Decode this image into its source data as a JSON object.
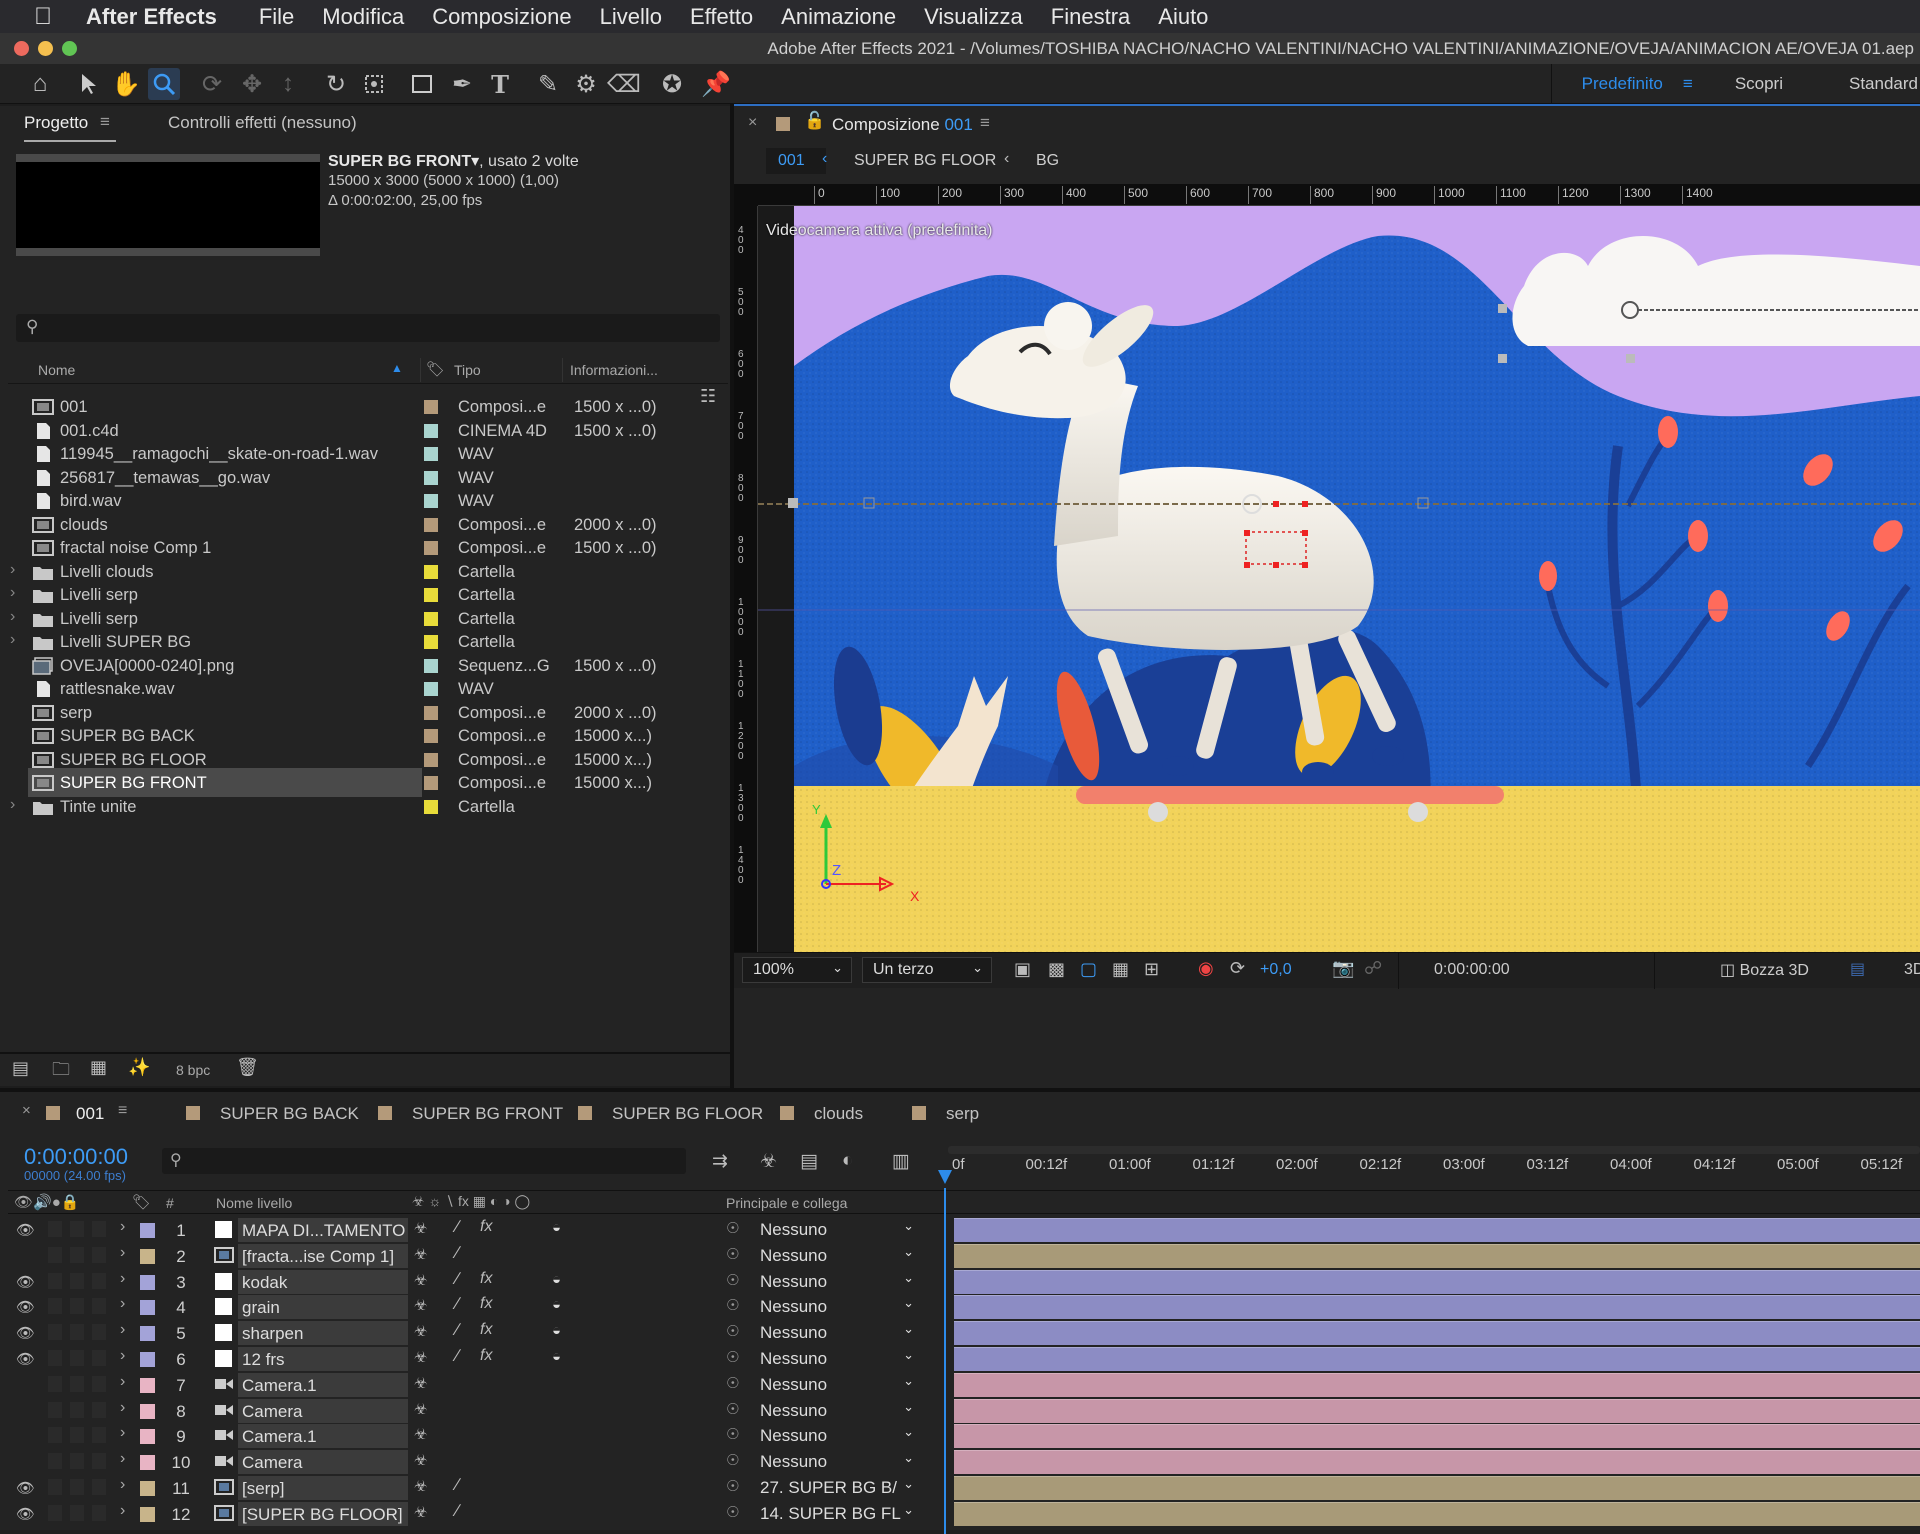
{
  "menubar": {
    "apple": "",
    "app": "After Effects",
    "items": [
      "File",
      "Modifica",
      "Composizione",
      "Livello",
      "Effetto",
      "Animazione",
      "Visualizza",
      "Finestra",
      "Aiuto"
    ]
  },
  "window_title": "Adobe After Effects 2021 - /Volumes/TOSHIBA NACHO/NACHO VALENTINI/NACHO VALENTINI/ANIMAZIONE/OVEJA/ANIMACION AE/OVEJA 01.aep",
  "workspace": {
    "active": "Predefinito",
    "items": [
      "Scopri",
      "Standard"
    ]
  },
  "project_panel": {
    "tab": "Progetto",
    "tab2": "Controlli effetti (nessuno)",
    "selected_name": "SUPER BG FRONT▾",
    "selected_usage": ", usato 2 volte",
    "selected_dims": "15000 x 3000  (5000 x 1000) (1,00)",
    "selected_dur": "Δ 0:00:02:00, 25,00 fps",
    "columns": [
      "Nome",
      "Tipo",
      "Informazioni..."
    ],
    "bpc": "8 bpc",
    "items": [
      {
        "name": "001",
        "type": "Composi...e",
        "info": "1500 x ...0)",
        "color": "#b49a7a",
        "icon": "comp",
        "folder": false
      },
      {
        "name": "001.c4d",
        "type": "CINEMA 4D",
        "info": "1500 x ...0)",
        "color": "#a9d4cf",
        "icon": "file",
        "folder": false
      },
      {
        "name": "119945__ramagochi__skate-on-road-1.wav",
        "type": "WAV",
        "info": "",
        "color": "#a9d4cf",
        "icon": "file",
        "folder": false
      },
      {
        "name": "256817__temawas__go.wav",
        "type": "WAV",
        "info": "",
        "color": "#a9d4cf",
        "icon": "file",
        "folder": false
      },
      {
        "name": "bird.wav",
        "type": "WAV",
        "info": "",
        "color": "#a9d4cf",
        "icon": "file",
        "folder": false
      },
      {
        "name": "clouds",
        "type": "Composi...e",
        "info": "2000 x ...0)",
        "color": "#b49a7a",
        "icon": "comp",
        "folder": false
      },
      {
        "name": "fractal noise Comp 1",
        "type": "Composi...e",
        "info": "1500 x ...0)",
        "color": "#b49a7a",
        "icon": "comp",
        "folder": false
      },
      {
        "name": "Livelli clouds",
        "type": "Cartella",
        "info": "",
        "color": "#e8dc3a",
        "icon": "folder",
        "folder": true
      },
      {
        "name": "Livelli serp",
        "type": "Cartella",
        "info": "",
        "color": "#e8dc3a",
        "icon": "folder",
        "folder": true
      },
      {
        "name": "Livelli serp",
        "type": "Cartella",
        "info": "",
        "color": "#e8dc3a",
        "icon": "folder",
        "folder": true
      },
      {
        "name": "Livelli SUPER BG",
        "type": "Cartella",
        "info": "",
        "color": "#e8dc3a",
        "icon": "folder",
        "folder": true
      },
      {
        "name": "OVEJA[0000-0240].png",
        "type": "Sequenz...G",
        "info": "1500 x ...0)",
        "color": "#a9d4cf",
        "icon": "seq",
        "folder": false
      },
      {
        "name": "rattlesnake.wav",
        "type": "WAV",
        "info": "",
        "color": "#a9d4cf",
        "icon": "file",
        "folder": false
      },
      {
        "name": "serp",
        "type": "Composi...e",
        "info": "2000 x ...0)",
        "color": "#b49a7a",
        "icon": "comp",
        "folder": false
      },
      {
        "name": "SUPER BG BACK",
        "type": "Composi...e",
        "info": "15000 x...)",
        "color": "#b49a7a",
        "icon": "comp",
        "folder": false
      },
      {
        "name": "SUPER BG FLOOR",
        "type": "Composi...e",
        "info": "15000 x...)",
        "color": "#b49a7a",
        "icon": "comp",
        "folder": false
      },
      {
        "name": "SUPER BG FRONT",
        "type": "Composi...e",
        "info": "15000 x...)",
        "color": "#b49a7a",
        "icon": "comp",
        "folder": false,
        "selected": true
      },
      {
        "name": "Tinte unite",
        "type": "Cartella",
        "info": "",
        "color": "#e8dc3a",
        "icon": "folder",
        "folder": true
      }
    ]
  },
  "comp_panel": {
    "tab_prefix": "Composizione",
    "tab_name": "001",
    "breadcrumbs": [
      "001",
      "SUPER BG FLOOR",
      "BG"
    ],
    "ruler": [
      "0",
      "100",
      "200",
      "300",
      "400",
      "500",
      "600",
      "700",
      "800",
      "900",
      "1000",
      "1100",
      "1200",
      "1300",
      "1400"
    ],
    "vruler": [
      "4 0 0",
      "5 0 0",
      "6 0 0",
      "7 0 0",
      "8 0 0",
      "9 0 0",
      "1 0 0 0",
      "1 1 0 0",
      "1 2 0 0",
      "1 3 0 0",
      "1 4 0 0"
    ],
    "camera_label": "Videocamera attiva (predefinita)",
    "axis": {
      "y": "Y",
      "z": "Z",
      "x": "X"
    },
    "zoom": "100%",
    "resolution": "Un terzo",
    "exposure": "+0,0",
    "timecode": "0:00:00:00",
    "renderer": "Bozza 3D",
    "extra": "3D"
  },
  "timeline": {
    "tabs": [
      "001",
      "SUPER BG BACK",
      "SUPER BG FRONT",
      "SUPER BG FLOOR",
      "clouds",
      "serp"
    ],
    "tab_colors": [
      "#b49a7a",
      "#b49a7a",
      "#b49a7a",
      "#b49a7a",
      "#b49a7a",
      "#b49a7a"
    ],
    "timecode": "0:00:00:00",
    "frame": "00000 (24.00 fps)",
    "header_num": "#",
    "header_name": "Nome livello",
    "header_parent": "Principale e collega",
    "ruler": [
      "0f",
      "00:12f",
      "01:00f",
      "01:12f",
      "02:00f",
      "02:12f",
      "03:00f",
      "03:12f",
      "04:00f",
      "04:12f",
      "05:00f",
      "05:12f"
    ],
    "layers": [
      {
        "num": "1",
        "name": "MAPA DI...TAMENTO",
        "parent": "Nessuno",
        "label": "#a3a3d8",
        "src": "solid",
        "eye": true,
        "fx": true,
        "adj": true,
        "bar": "#8c8cc4"
      },
      {
        "num": "2",
        "name": "[fracta...ise Comp 1]",
        "parent": "Nessuno",
        "label": "#c8b48a",
        "src": "comp",
        "eye": false,
        "fx": false,
        "adj": false,
        "bar": "#a89a78"
      },
      {
        "num": "3",
        "name": "kodak",
        "parent": "Nessuno",
        "label": "#a3a3d8",
        "src": "solid",
        "eye": true,
        "fx": true,
        "adj": true,
        "bar": "#8c8cc4"
      },
      {
        "num": "4",
        "name": "grain",
        "parent": "Nessuno",
        "label": "#a3a3d8",
        "src": "solid",
        "eye": true,
        "fx": true,
        "adj": true,
        "bar": "#8c8cc4"
      },
      {
        "num": "5",
        "name": "sharpen",
        "parent": "Nessuno",
        "label": "#a3a3d8",
        "src": "solid",
        "eye": true,
        "fx": true,
        "adj": true,
        "bar": "#8c8cc4"
      },
      {
        "num": "6",
        "name": "12 frs",
        "parent": "Nessuno",
        "label": "#a3a3d8",
        "src": "solid",
        "eye": true,
        "fx": true,
        "adj": true,
        "bar": "#8c8cc4"
      },
      {
        "num": "7",
        "name": "Camera.1",
        "parent": "Nessuno",
        "label": "#e8b4c4",
        "src": "camera",
        "eye": false,
        "fx": false,
        "adj": false,
        "bar": "#c796a8"
      },
      {
        "num": "8",
        "name": "Camera",
        "parent": "Nessuno",
        "label": "#e8b4c4",
        "src": "camera",
        "eye": false,
        "fx": false,
        "adj": false,
        "bar": "#c796a8"
      },
      {
        "num": "9",
        "name": "Camera.1",
        "parent": "Nessuno",
        "label": "#e8b4c4",
        "src": "camera",
        "eye": false,
        "fx": false,
        "adj": false,
        "bar": "#c796a8"
      },
      {
        "num": "10",
        "name": "Camera",
        "parent": "Nessuno",
        "label": "#e8b4c4",
        "src": "camera",
        "eye": false,
        "fx": false,
        "adj": false,
        "bar": "#c796a8"
      },
      {
        "num": "11",
        "name": "[serp]",
        "parent": "27. SUPER BG B/",
        "label": "#c8b48a",
        "src": "comp",
        "eye": true,
        "fx": false,
        "adj": false,
        "bar": "#a89a78"
      },
      {
        "num": "12",
        "name": "[SUPER BG FLOOR]",
        "parent": "14. SUPER BG FL",
        "label": "#c8b48a",
        "src": "comp",
        "eye": true,
        "fx": false,
        "adj": false,
        "bar": "#a89a78"
      }
    ]
  },
  "colors": {
    "accent": "#2d8ceb",
    "sky": "#c9a6f2",
    "mountain": "#1f5fc9",
    "floor": "#f2d35a"
  }
}
